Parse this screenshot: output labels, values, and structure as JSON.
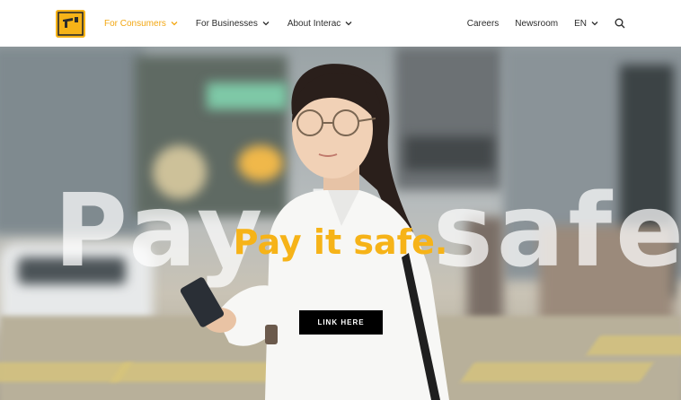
{
  "nav": {
    "logo_icon": "interac-logo-icon",
    "left_items": [
      {
        "label": "For Consumers",
        "active": true
      },
      {
        "label": "For Businesses",
        "active": false
      },
      {
        "label": "About Interac",
        "active": false
      }
    ],
    "right_items": {
      "careers": "Careers",
      "newsroom": "Newsroom",
      "language": "EN"
    },
    "search_icon": "search-icon"
  },
  "hero": {
    "background_text": "Pay it safe.",
    "headline": "Pay it safe.",
    "cta_label": "LINK HERE"
  },
  "colors": {
    "accent": "#f6b318",
    "active_nav": "#f3a712",
    "cta_bg": "#000000"
  }
}
